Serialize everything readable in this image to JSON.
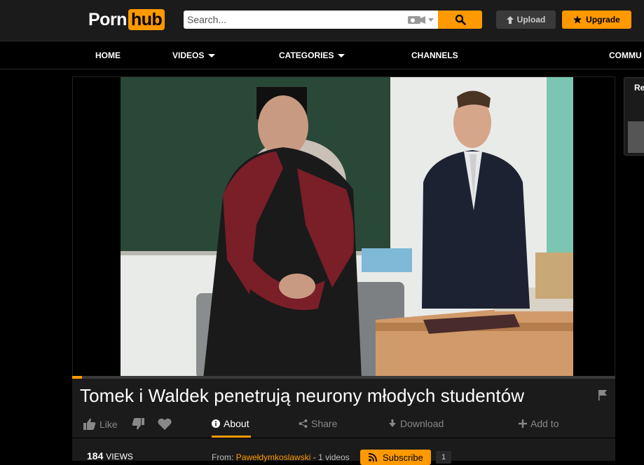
{
  "header": {
    "logo_left": "Porn",
    "logo_right": "hub",
    "search_placeholder": "Search...",
    "upload_label": "Upload",
    "upgrade_label": "Upgrade",
    "accent_color": "#ff9900"
  },
  "nav": {
    "items": [
      {
        "label": "HOME",
        "has_caret": false
      },
      {
        "label": "VIDEOS",
        "has_caret": true
      },
      {
        "label": "CATEGORIES",
        "has_caret": true
      },
      {
        "label": "CHANNELS",
        "has_caret": false
      },
      {
        "label": "COMMU",
        "has_caret": false
      }
    ]
  },
  "sidebar": {
    "title": "Re"
  },
  "video": {
    "title": "Tomek i Waldek penetrują neurony młodych studentów",
    "progress_fraction": 0.018,
    "views_count": "184",
    "views_label": "VIEWS",
    "from_label": "From:",
    "uploader": "Pawełdymkoslawski",
    "uploader_videos": "- 1 videos",
    "subscribe_label": "Subscribe",
    "subscriber_count": "1"
  },
  "actions": {
    "like": "Like",
    "about": "About",
    "share": "Share",
    "download": "Download",
    "add_to": "Add to"
  },
  "icons": {
    "search": "search-icon",
    "camera": "camera-icon",
    "upload": "upload-arrow-icon",
    "upgrade": "star-icon",
    "like": "thumbs-up-icon",
    "dislike": "thumbs-down-icon",
    "favorite": "heart-icon",
    "info": "info-icon",
    "share": "share-icon",
    "download": "download-icon",
    "add": "plus-icon",
    "flag": "flag-icon",
    "rss": "rss-icon"
  }
}
